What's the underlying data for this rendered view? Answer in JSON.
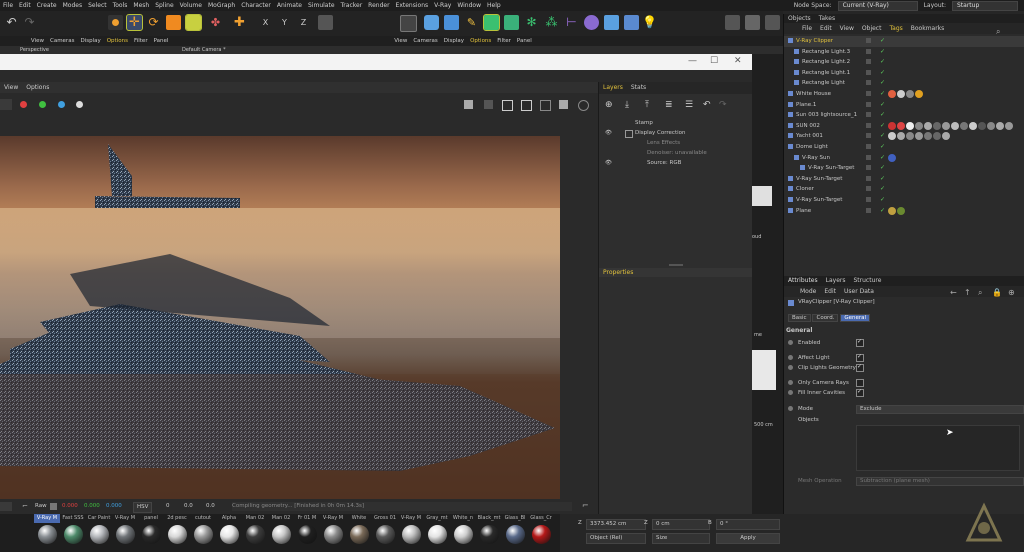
{
  "menubar": {
    "items": [
      "File",
      "Edit",
      "Create",
      "Modes",
      "Select",
      "Tools",
      "Mesh",
      "Spline",
      "Volume",
      "MoGraph",
      "Character",
      "Animate",
      "Simulate",
      "Tracker",
      "Render",
      "Extensions",
      "V-Ray",
      "Window",
      "Help"
    ],
    "node_space_label": "Node Space:",
    "node_space_value": "Current (V-Ray)",
    "layout_label": "Layout:",
    "layout_value": "Startup"
  },
  "viewport": {
    "menu_left": [
      "View",
      "Cameras",
      "Display",
      "Options",
      "Filter",
      "Panel"
    ],
    "menu_right": [
      "View",
      "Cameras",
      "Display",
      "Options",
      "Filter",
      "Panel"
    ],
    "left_title": "Perspective",
    "camera_title": "Default Camera *"
  },
  "vfb": {
    "menu": [
      "View",
      "Options"
    ],
    "layers_tabs": [
      "Layers",
      "Stats"
    ],
    "layers": [
      {
        "name": "Stamp"
      },
      {
        "name": "Display Correction"
      },
      {
        "name": "Lens Effects"
      },
      {
        "name": "Denoiser: unavailable"
      },
      {
        "name": "Source: RGB"
      }
    ],
    "properties_title": "Properties",
    "bottom": {
      "raw": "Raw",
      "v1": "0.000",
      "v2": "0.000",
      "v3": "0.000",
      "mode": "HSV",
      "h1": "0",
      "h2": "0.0",
      "h3": "0.0",
      "status": "Compiling geometry... [Finished in 0h 0m 14.3s]"
    }
  },
  "strip_labels": [
    "oud",
    "me",
    "500 cm"
  ],
  "objects": {
    "tabs": [
      "Objects",
      "Takes"
    ],
    "menu": [
      "File",
      "Edit",
      "View",
      "Object",
      "Tags",
      "Bookmarks"
    ],
    "rows": [
      {
        "name": "V-Ray Clipper",
        "indent": 1,
        "selected": true
      },
      {
        "name": "Rectangle Light.3",
        "indent": 2
      },
      {
        "name": "Rectangle Light.2",
        "indent": 2
      },
      {
        "name": "Rectangle Light.1",
        "indent": 2
      },
      {
        "name": "Rectangle Light",
        "indent": 2
      },
      {
        "name": "White House",
        "indent": 1
      },
      {
        "name": "Plane.1",
        "indent": 1
      },
      {
        "name": "Sun 003 lightsource_1",
        "indent": 1
      },
      {
        "name": "SUN 002",
        "indent": 1
      },
      {
        "name": "Yacht 001",
        "indent": 1
      },
      {
        "name": "Dome Light",
        "indent": 1
      },
      {
        "name": "V-Ray Sun",
        "indent": 2
      },
      {
        "name": "V-Ray Sun-Target",
        "indent": 3
      },
      {
        "name": "V-Ray Sun-Target",
        "indent": 1
      },
      {
        "name": "Cloner",
        "indent": 1
      },
      {
        "name": "V-Ray Sun-Target",
        "indent": 1
      },
      {
        "name": "Plane",
        "indent": 1
      }
    ]
  },
  "attributes": {
    "tabs": [
      "Attributes",
      "Layers",
      "Structure"
    ],
    "menu": [
      "Mode",
      "Edit",
      "User Data"
    ],
    "object_title": "VRayClipper [V-Ray Clipper]",
    "subtabs": [
      "Basic",
      "Coord.",
      "General"
    ],
    "section": "General",
    "rows": [
      {
        "label": "Enabled",
        "checked": true
      },
      {
        "label": "Affect Light",
        "checked": true
      },
      {
        "label": "Clip Lights Geometry",
        "checked": true
      },
      {
        "label": "Only Camera Rays",
        "checked": false
      },
      {
        "label": "Fill Inner Cavities",
        "checked": true
      }
    ],
    "mode_label": "Mode",
    "mode_value": "Exclude",
    "objects_label": "Objects",
    "mesh_operation_label": "Mesh Operation",
    "mesh_operation_value": "Subtraction (plane mesh)"
  },
  "materials": [
    {
      "name": "V-Ray M",
      "color": "#8a8f94"
    },
    {
      "name": "Fast SSS",
      "color": "#4d8a6a"
    },
    {
      "name": "Car Paint",
      "color": "#b5b8bc"
    },
    {
      "name": "V-Ray M",
      "color": "#707478"
    },
    {
      "name": "panel",
      "color": "#2a2a2a"
    },
    {
      "name": "2d pesc",
      "color": "#d8d8d8"
    },
    {
      "name": "cutout",
      "color": "#9a9a9a"
    },
    {
      "name": "Alpha",
      "color": "#e6e6e6"
    },
    {
      "name": "Man 02",
      "color": "#3d3d3d"
    },
    {
      "name": "Man 02",
      "color": "#c7c7c7"
    },
    {
      "name": "Fr 01 M",
      "color": "#1f1f1f"
    },
    {
      "name": "V-Ray M",
      "color": "#8c8c8c"
    },
    {
      "name": "White",
      "color": "#7a6a58"
    },
    {
      "name": "Gross 01",
      "color": "#5a5a5a"
    },
    {
      "name": "V-Ray M",
      "color": "#bdbdbd"
    },
    {
      "name": "Gray_mt",
      "color": "#e4e4e4"
    },
    {
      "name": "White_n",
      "color": "#cfcfcf"
    },
    {
      "name": "Black_mt",
      "color": "#2a2a2a"
    },
    {
      "name": "Glass_Bl",
      "color": "#5a6a8a"
    },
    {
      "name": "Glass_Cr",
      "color": "#b51818"
    }
  ],
  "coords": {
    "z_label": "Z",
    "z_value": "3373.452 cm",
    "z2_label": "Z",
    "z2_value": "0 cm",
    "b_label": "B",
    "b_value": "0 °",
    "object_mode": "Object (Rel)",
    "size_mode": "Size",
    "apply": "Apply"
  }
}
